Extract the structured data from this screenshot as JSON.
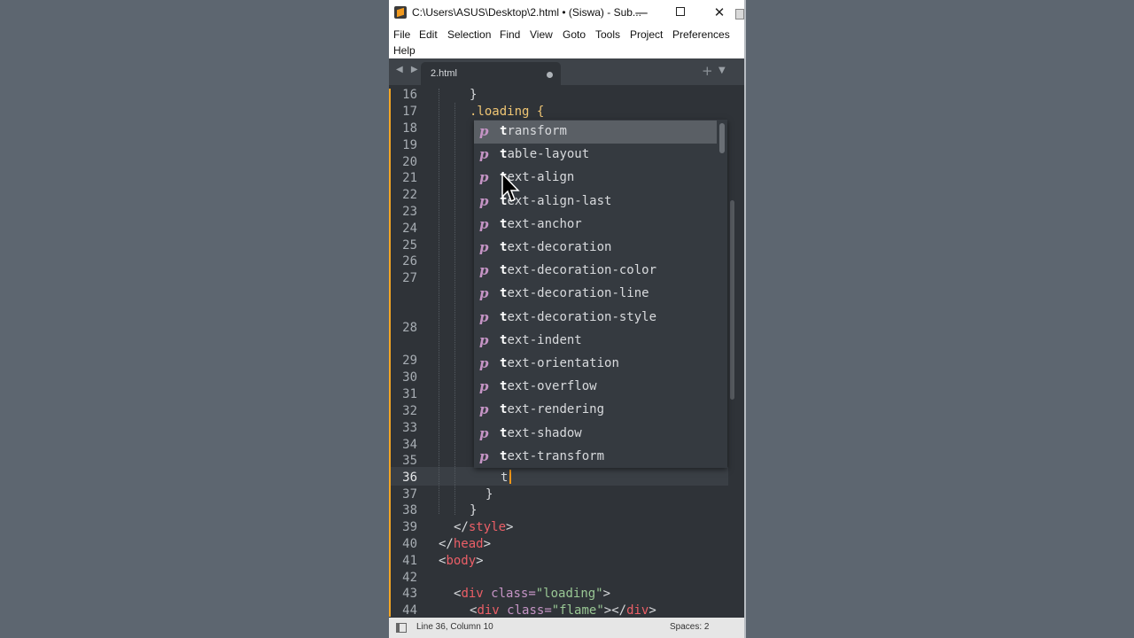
{
  "window": {
    "title": "C:\\Users\\ASUS\\Desktop\\2.html • (Siswa) - Sub...",
    "minimize_glyph": "—",
    "close_glyph": "✕"
  },
  "menu": {
    "items": [
      "File",
      "Edit",
      "Selection",
      "Find",
      "View",
      "Goto",
      "Tools",
      "Project",
      "Preferences",
      "Help"
    ]
  },
  "tabs": {
    "nav_arrows": "◀ ▶",
    "active": "2.html",
    "new_tab_glyph": "+",
    "dropdown_glyph": "▼"
  },
  "editor": {
    "line_numbers": [
      "16",
      "17",
      "18",
      "19",
      "20",
      "21",
      "22",
      "23",
      "24",
      "25",
      "26",
      "27",
      "28",
      "29",
      "30",
      "31",
      "32",
      "33",
      "34",
      "35",
      "36",
      "37",
      "38",
      "39",
      "40",
      "41",
      "42",
      "43",
      "44"
    ],
    "current_line": "36",
    "code": {
      "l16": "}",
      "l17_sel": ".loading",
      "l17_brace": "{",
      "l36": "t",
      "l37": "}",
      "l38": "}",
      "l39_open": "</",
      "l39_tag": "style",
      "l39_close": ">",
      "l40_open": "</",
      "l40_tag": "head",
      "l40_close": ">",
      "l41_open": "<",
      "l41_tag": "body",
      "l41_close": ">",
      "l43_open": "<",
      "l43_tag": "div",
      "l43_attr": "class=",
      "l43_str": "\"loading\"",
      "l43_close": ">",
      "l44_open": "<",
      "l44_tag": "div",
      "l44_attr": "class=",
      "l44_str": "\"flame\"",
      "l44_mid": "></",
      "l44_tag2": "div",
      "l44_close": ">"
    }
  },
  "autocomplete": {
    "kind_glyph": "p",
    "typed": "t",
    "selected_index": 0,
    "items": [
      {
        "match": "t",
        "rest": "ransform"
      },
      {
        "match": "t",
        "rest": "able-layout"
      },
      {
        "match": "t",
        "rest": "ext-align"
      },
      {
        "match": "t",
        "rest": "ext-align-last"
      },
      {
        "match": "t",
        "rest": "ext-anchor"
      },
      {
        "match": "t",
        "rest": "ext-decoration"
      },
      {
        "match": "t",
        "rest": "ext-decoration-color"
      },
      {
        "match": "t",
        "rest": "ext-decoration-line"
      },
      {
        "match": "t",
        "rest": "ext-decoration-style"
      },
      {
        "match": "t",
        "rest": "ext-indent"
      },
      {
        "match": "t",
        "rest": "ext-orientation"
      },
      {
        "match": "t",
        "rest": "ext-overflow"
      },
      {
        "match": "t",
        "rest": "ext-rendering"
      },
      {
        "match": "t",
        "rest": "ext-shadow"
      },
      {
        "match": "t",
        "rest": "ext-transform"
      }
    ]
  },
  "status": {
    "position": "Line 36, Column 10",
    "spaces": "Spaces: 2"
  },
  "colors": {
    "editor_bg": "#2f3338",
    "gutter_modified": "#f5a623",
    "keyword_property": "#c594c5",
    "tag": "#ec5f67",
    "string": "#99c794",
    "selector": "#f0c674",
    "cursor": "#f29718"
  }
}
